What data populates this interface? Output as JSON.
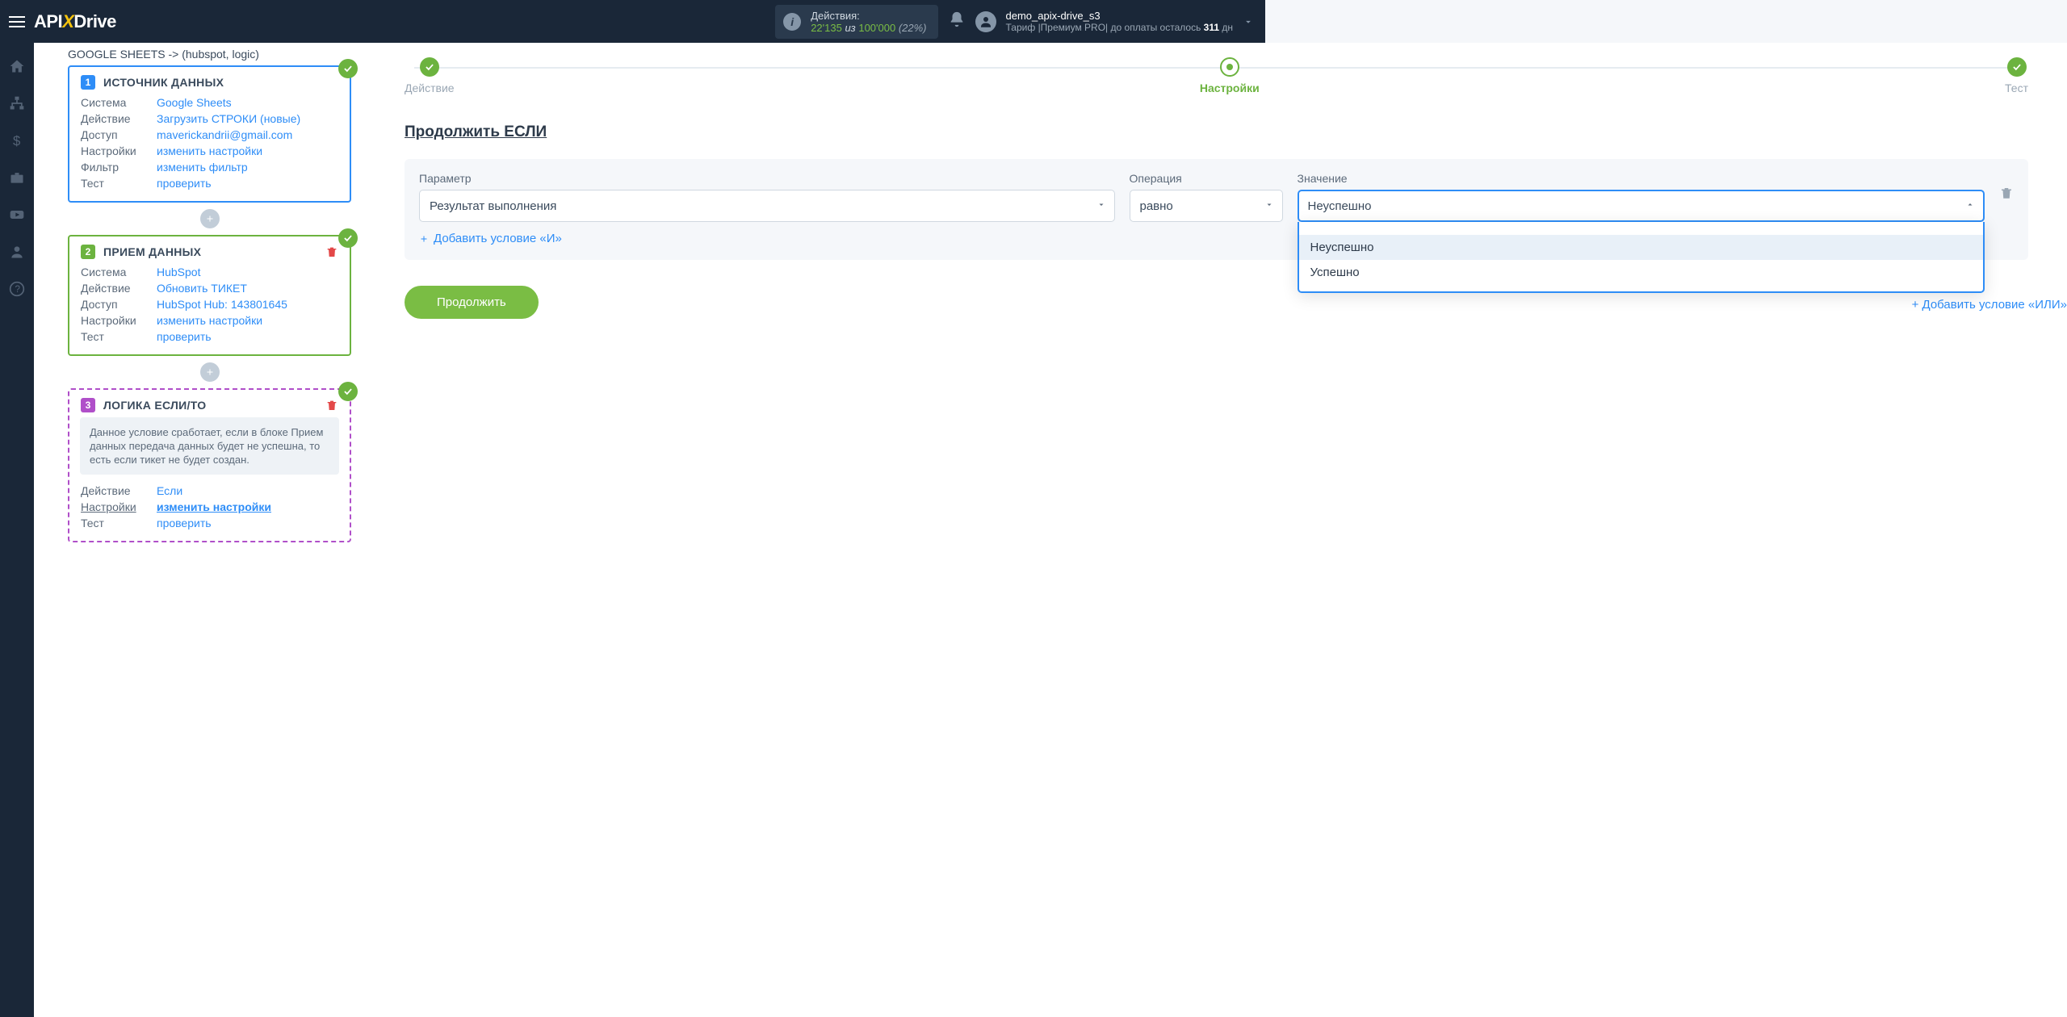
{
  "header": {
    "logo": {
      "api": "API",
      "x": "X",
      "drive": "Drive"
    },
    "actions_label": "Действия:",
    "actions_used": "22'135",
    "actions_of": " из ",
    "actions_total": "100'000",
    "actions_pct": " (22%)",
    "user_name": "demo_apix-drive_s3",
    "user_sub_prefix": "Тариф |Премиум PRO| до оплаты осталось ",
    "user_days": "311",
    "user_sub_suffix": " дн"
  },
  "left": {
    "breadcrumb": "GOOGLE SHEETS -> (hubspot, logic)",
    "block1": {
      "num": "1",
      "title": "ИСТОЧНИК ДАННЫХ",
      "rows": {
        "system_l": "Система",
        "system_v": "Google Sheets",
        "action_l": "Действие",
        "action_v": "Загрузить СТРОКИ (новые)",
        "access_l": "Доступ",
        "access_v": "maverickandrii@gmail.com",
        "settings_l": "Настройки",
        "settings_v": "изменить настройки",
        "filter_l": "Фильтр",
        "filter_v": "изменить фильтр",
        "test_l": "Тест",
        "test_v": "проверить"
      }
    },
    "block2": {
      "num": "2",
      "title": "ПРИЕМ ДАННЫХ",
      "rows": {
        "system_l": "Система",
        "system_v": "HubSpot",
        "action_l": "Действие",
        "action_v": "Обновить ТИКЕТ",
        "access_l": "Доступ",
        "access_v": "HubSpot Hub: 143801645",
        "settings_l": "Настройки",
        "settings_v": "изменить настройки",
        "test_l": "Тест",
        "test_v": "проверить"
      }
    },
    "block3": {
      "num": "3",
      "title": "ЛОГИКА ЕСЛИ/ТО",
      "note": "Данное условие сработает, если в блоке Прием данных передача данных будет не успешна, то есть если тикет не будет создан.",
      "rows": {
        "action_l": "Действие",
        "action_v": "Если",
        "settings_l": "Настройки",
        "settings_v": "изменить настройки",
        "test_l": "Тест",
        "test_v": "проверить"
      }
    }
  },
  "right": {
    "steps": {
      "s1": "Действие",
      "s2": "Настройки",
      "s3": "Тест"
    },
    "section_title": "Продолжить ЕСЛИ",
    "filter": {
      "param_l": "Параметр",
      "param_v": "Результат выполнения",
      "op_l": "Операция",
      "op_v": "равно",
      "val_l": "Значение",
      "val_v": "Неуспешно",
      "options": {
        "o1": "Неуспешно",
        "o2": "Успешно"
      }
    },
    "add_and": "Добавить условие «И»",
    "add_or": "+ Добавить условие «ИЛИ»",
    "continue_btn": "Продолжить"
  }
}
